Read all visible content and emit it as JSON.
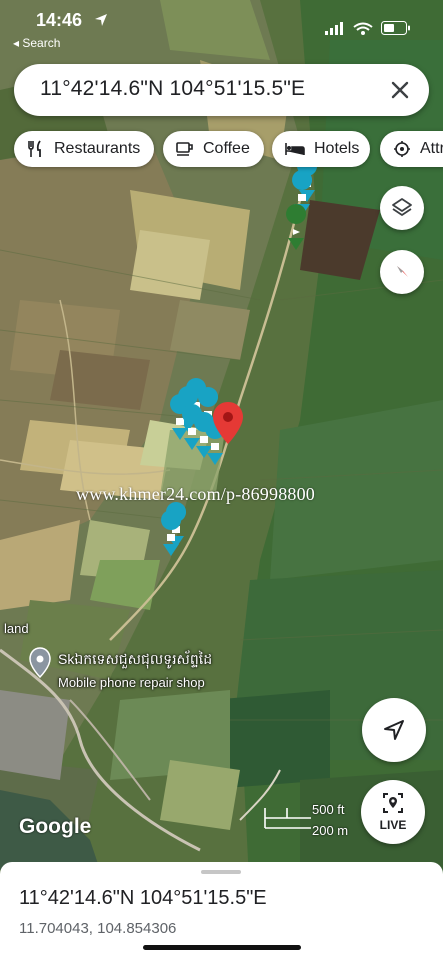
{
  "status_bar": {
    "time": "14:46",
    "back_label": "◂ Search"
  },
  "search": {
    "query": "11°42'14.6\"N 104°51'15.5\"E"
  },
  "chips": [
    {
      "label": "Restaurants",
      "icon": "fork-knife-icon"
    },
    {
      "label": "Coffee",
      "icon": "coffee-cup-icon"
    },
    {
      "label": "Hotels",
      "icon": "bed-icon"
    },
    {
      "label": "Attr",
      "icon": "attractions-icon"
    }
  ],
  "map": {
    "watermark": "www.khmer24.com/p-86998800",
    "label_land": "land",
    "poi_name": "Skឯកទេសជួសជុលទូរស័ព្ទដៃ",
    "poi_category": "Mobile phone repair shop",
    "attribution": "Google",
    "scale_ft": "500 ft",
    "scale_m": "200 m",
    "live_label": "LIVE"
  },
  "place": {
    "title": "11°42'14.6\"N 104°51'15.5\"E",
    "decimal_coords": "11.704043, 104.854306"
  },
  "colors": {
    "accent_red": "#e53935",
    "pin_teal": "#18a3c4",
    "pin_green": "#2e7d32"
  }
}
